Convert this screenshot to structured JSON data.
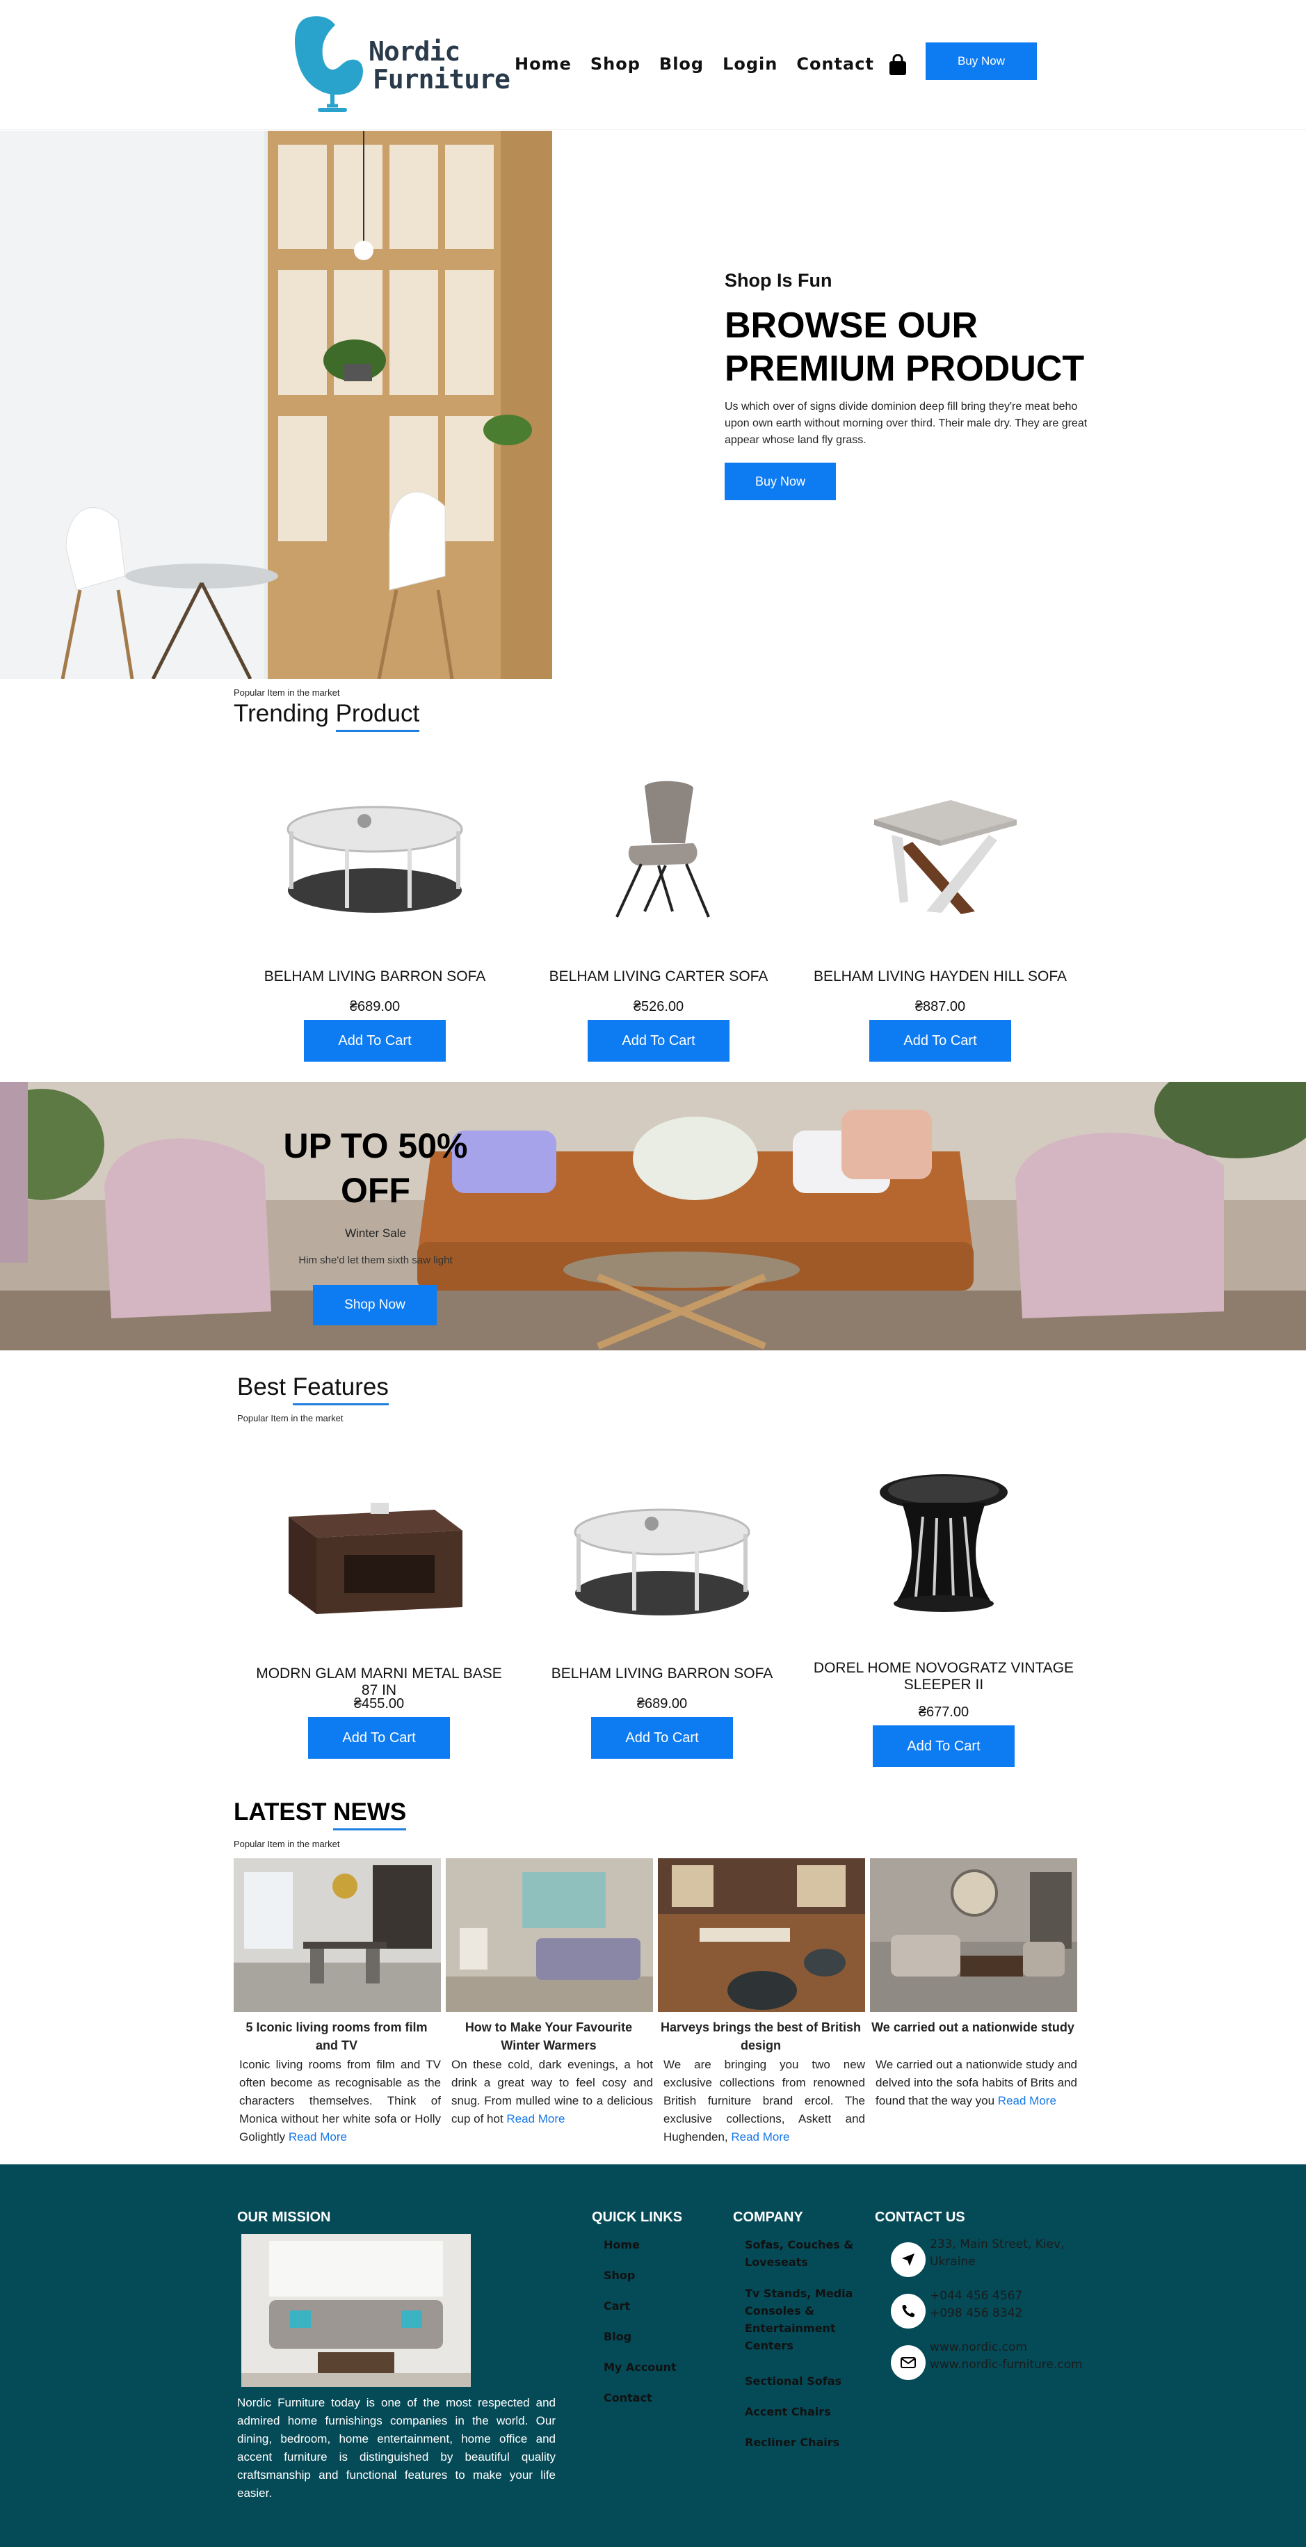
{
  "header": {
    "logo_line1": "Nordic",
    "logo_line2": "Furniture",
    "nav": [
      "Home",
      "Shop",
      "Blog",
      "Login",
      "Contact"
    ],
    "cart_icon": "shopping-bag-icon",
    "buy_now": "Buy Now"
  },
  "hero": {
    "kicker": "Shop Is Fun",
    "title_line1": "BROWSE OUR",
    "title_line2": "PREMIUM PRODUCT",
    "description": "Us which over of signs divide dominion deep fill bring they're meat beho upon own earth without morning over third. Their male dry. They are great appear whose land fly grass.",
    "button": "Buy Now"
  },
  "trending": {
    "kicker": "Popular Item in the market",
    "title_a": "Trending ",
    "title_b": "Product",
    "products": [
      {
        "name": "BELHAM LIVING BARRON SOFA",
        "price": "₴689.00",
        "button": "Add To Cart"
      },
      {
        "name": "BELHAM LIVING CARTER SOFA",
        "price": "₴526.00",
        "button": "Add To Cart"
      },
      {
        "name": "BELHAM LIVING HAYDEN HILL SOFA",
        "price": "₴887.00",
        "button": "Add To Cart"
      }
    ]
  },
  "promo": {
    "title_line1": "UP TO 50%",
    "title_line2": "OFF",
    "subtitle": "Winter Sale",
    "note": "Him she'd let them sixth saw light",
    "button": "Shop Now"
  },
  "features": {
    "title_a": "Best ",
    "title_b": "Features",
    "kicker": "Popular Item in the market",
    "products": [
      {
        "name": "MODRN GLAM MARNI METAL BASE 87 IN",
        "price": "₴455.00",
        "button": "Add To Cart"
      },
      {
        "name": "BELHAM LIVING BARRON SOFA",
        "price": "₴689.00",
        "button": "Add To Cart"
      },
      {
        "name": "DOREL HOME NOVOGRATZ VINTAGE SLEEPER II",
        "price": "₴677.00",
        "button": "Add To Cart"
      }
    ]
  },
  "news": {
    "title_a": "LATEST ",
    "title_b": "NEWS",
    "kicker": "Popular Item in the market",
    "read_more": "Read More",
    "items": [
      {
        "title": "5 Iconic living rooms from film and TV",
        "body": "Iconic living rooms from film and TV often become as recognisable as the characters themselves. Think of Monica without her white sofa or Holly Golightly"
      },
      {
        "title": "How to Make Your Favourite Winter Warmers",
        "body": "On these cold, dark evenings, a hot drink a great way to feel cosy and snug. From mulled wine to a delicious cup of hot"
      },
      {
        "title": "Harveys brings the best of British design",
        "body": "We are bringing you two new exclusive collections from renowned British furniture brand ercol. The exclusive collections, Askett and Hughenden,"
      },
      {
        "title": "We carried out a nationwide study",
        "body": "We carried out a nationwide study and delved into the sofa habits of Brits and found that the way you"
      }
    ]
  },
  "footer": {
    "mission_title": "OUR MISSION",
    "mission_text": "Nordic Furniture today is one of the most respected and admired home furnishings companies in the world. Our dining, bedroom, home entertainment, home office and accent furniture is distinguished by beautiful quality craftsmanship and functional features to make your life easier.",
    "quick_title": "QUICK LINKS",
    "quick_links": [
      "Home",
      "Shop",
      "Cart",
      "Blog",
      "My Account",
      "Contact"
    ],
    "company_title": "COMPANY",
    "company_links": [
      "Sofas, Couches & Loveseats",
      "Tv Stands, Media Consoles & Entertainment Centers",
      "Sectional Sofas",
      "Accent Chairs",
      "Recliner Chairs"
    ],
    "contact_title": "CONTACT US",
    "address_line1": "233, Main Street, Kiev,",
    "address_line2": "Ukraine",
    "phone1": "+044 456 4567",
    "phone2": "+098 456 8342",
    "web1": "www.nordic.com",
    "web2": "www.nordic-furniture.com"
  },
  "colors": {
    "accent": "#0d7bf2",
    "footer": "#054a57",
    "logo": "#29a3cc"
  }
}
